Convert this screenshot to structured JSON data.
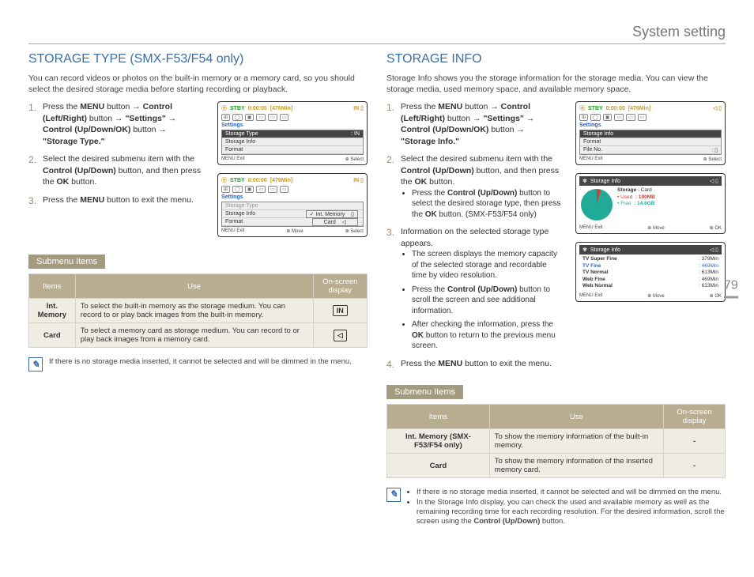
{
  "pageTitle": "System setting",
  "pageNumber": "79",
  "left": {
    "heading": "STORAGE TYPE (SMX-F53/F54 only)",
    "intro": "You can record videos or photos on the built-in memory or a memory card, so you should select the desired storage media before starting recording or playback.",
    "step1_a": "Press the ",
    "step1_menu": "MENU",
    "step1_b": " button → ",
    "step1_ctrl": "Control (Left/Right)",
    "step1_c": " button → ",
    "step1_settings": "\"Settings\"",
    "step1_d": " → ",
    "step1_ctrl2": "Control (Up/Down/OK)",
    "step1_e": " button → ",
    "step1_target": "\"Storage Type.\"",
    "step2_a": "Select the desired submenu item with the ",
    "step2_ctrl": "Control (Up/Down)",
    "step2_b": " button, and then press the ",
    "step2_ok": "OK",
    "step2_c": " button.",
    "step3_a": "Press the ",
    "step3_menu": "MENU",
    "step3_b": " button to exit the menu.",
    "lcd_stby": "STBY",
    "lcd_time": "0:00:00",
    "lcd_remain": "[476Min]",
    "lcd_settings": "Settings",
    "lcd_m1": "Storage Type",
    "lcd_m2": "Storage Info",
    "lcd_m3": "Format",
    "lcd_foot_exit": "MENU Exit",
    "lcd_foot_sel": "Select",
    "lcd_opt_int": "Int. Memory",
    "lcd_opt_card": "Card",
    "lcd_foot_move": "Move",
    "submenuLabel": "Submenu Items",
    "th_items": "Items",
    "th_use": "Use",
    "th_osd": "On-screen display",
    "row1_item": "Int. Memory",
    "row1_use": "To select the built-in memory as the storage medium. You can record to or play back images from the built-in memory.",
    "row1_osd": "IN",
    "row2_item": "Card",
    "row2_use": "To select a memory card as storage medium. You can record to or play back images from a memory card.",
    "row2_osd": "◁",
    "note": "If there is no storage media inserted, it cannot be selected and will be dimmed in the menu."
  },
  "right": {
    "heading": "STORAGE INFO",
    "intro": "Storage Info shows you the storage information for the storage media. You can view the storage media, used memory space, and available memory space.",
    "step1_a": "Press the ",
    "step1_menu": "MENU",
    "step1_b": " button → ",
    "step1_ctrl": "Control (Left/Right)",
    "step1_c": " button → ",
    "step1_settings": "\"Settings\"",
    "step1_d": " → ",
    "step1_ctrl2": "Control (Up/Down/OK)",
    "step1_e": " button → ",
    "step1_target": "\"Storage Info.\"",
    "step2_a": "Select the desired submenu item with the ",
    "step2_ctrl": "Control (Up/Down)",
    "step2_b": " button, and then press the ",
    "step2_ok": "OK",
    "step2_c": " button.",
    "step2_sub_a": "Press the ",
    "step2_sub_ctrl": "Control (Up/Down)",
    "step2_sub_b": " button to select the desired storage type, then press the ",
    "step2_sub_ok": "OK",
    "step2_sub_c": " button. (SMX-F53/F54 only)",
    "step3": "Information on the selected storage type appears.",
    "step3_sub1": "The screen displays the memory capacity of the selected storage and recordable time by video resolution.",
    "step3_sub2_a": "Press the ",
    "step3_sub2_ctrl": "Control (Up/Down)",
    "step3_sub2_b": " button to scroll the screen and see additional information.",
    "step3_sub3_a": "After checking the information, press the ",
    "step3_sub3_ok": "OK",
    "step3_sub3_b": " button to return to the previous menu screen.",
    "step4_a": "Press the ",
    "step4_menu": "MENU",
    "step4_b": " button to exit the menu.",
    "lcd1_m1": "Storage Info",
    "lcd1_m2": "Format",
    "lcd1_m3": "File No.",
    "lcd2_title": "Storage Info",
    "lcd2_storage": "Storage",
    "lcd2_storage_v": ": Card",
    "lcd2_used": "• Used",
    "lcd2_used_v": ": 190MB",
    "lcd2_free": "• Free",
    "lcd2_free_v": ": 14.6GB",
    "lcd2_foot_ok": "OK",
    "lcd3_r1": "TV Super Fine",
    "lcd3_r1v": ": 379Min",
    "lcd3_r2": "TV Fine",
    "lcd3_r2v": ": 469Min",
    "lcd3_r3": "TV Normal",
    "lcd3_r3v": ": 613Min",
    "lcd3_r4": "Web Fine",
    "lcd3_r4v": ": 469Min",
    "lcd3_r5": "Web Normal",
    "lcd3_r5v": ": 613Min",
    "submenuLabel": "Submenu Items",
    "row1_item": "Int. Memory (SMX-F53/F54 only)",
    "row1_use": "To show the memory information of the built-in memory.",
    "row1_osd": "-",
    "row2_item": "Card",
    "row2_use": "To show the memory information of the inserted memory card.",
    "row2_osd": "-",
    "note1": "If there is no storage media inserted, it cannot be selected and will be dimmed on the menu.",
    "note2_a": "In the Storage Info display, you can check the used and available memory as well as the remaining recording time for each recording resolution. For the desired information, scroll the screen using the ",
    "note2_ctrl": "Control (Up/Down)",
    "note2_b": " button."
  }
}
